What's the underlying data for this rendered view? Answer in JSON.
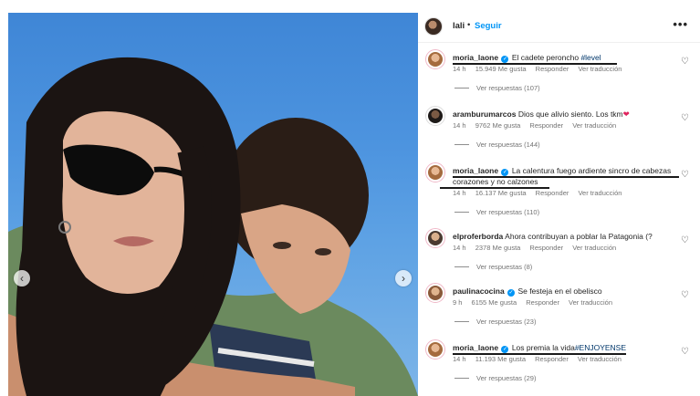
{
  "header": {
    "username": "lali",
    "separator": "•",
    "follow_label": "Seguir",
    "more_label": "•••"
  },
  "photo": {
    "prev_icon": "‹",
    "next_icon": "›"
  },
  "comments": [
    {
      "username": "moria_laone",
      "verified": true,
      "text": "El cadete peroncho ",
      "hashtag": "#level",
      "time": "14 h",
      "likes": "15.949 Me gusta",
      "reply": "Responder",
      "translate": "Ver traducción",
      "replies": "Ver respuestas (107)"
    },
    {
      "username": "aramburumarcos",
      "verified": false,
      "text": "Dios que alivio siento. Los tkm",
      "emoji": "❤",
      "time": "14 h",
      "likes": "9762 Me gusta",
      "reply": "Responder",
      "translate": "Ver traducción",
      "replies": "Ver respuestas (144)"
    },
    {
      "username": "moria_laone",
      "verified": true,
      "text": "La calentura fuego ardiente sincro de cabezas corazones y no calzones",
      "time": "14 h",
      "likes": "16.137 Me gusta",
      "reply": "Responder",
      "translate": "Ver traducción",
      "replies": "Ver respuestas (110)"
    },
    {
      "username": "elproferborda",
      "verified": false,
      "text": "Ahora contribuyan a poblar la Patagonia (?",
      "time": "14 h",
      "likes": "2378 Me gusta",
      "reply": "Responder",
      "translate": "Ver traducción",
      "replies": "Ver respuestas (8)"
    },
    {
      "username": "paulinacocina",
      "verified": true,
      "text": "Se festeja en el obelisco",
      "time": "9 h",
      "likes": "6155 Me gusta",
      "reply": "Responder",
      "translate": "Ver traducción",
      "replies": "Ver respuestas (23)"
    },
    {
      "username": "moria_laone",
      "verified": true,
      "text": "Los premia la vida",
      "hashtag": "#ENJOYENSE",
      "time": "14 h",
      "likes": "11.193 Me gusta",
      "reply": "Responder",
      "translate": "Ver traducción",
      "replies": "Ver respuestas (29)"
    }
  ],
  "icons": {
    "like": "heart-outline-icon",
    "verified": "verified-badge-icon"
  },
  "colors": {
    "link_blue": "#0095f6",
    "hashtag": "#00376b",
    "meta_gray": "#737373"
  }
}
